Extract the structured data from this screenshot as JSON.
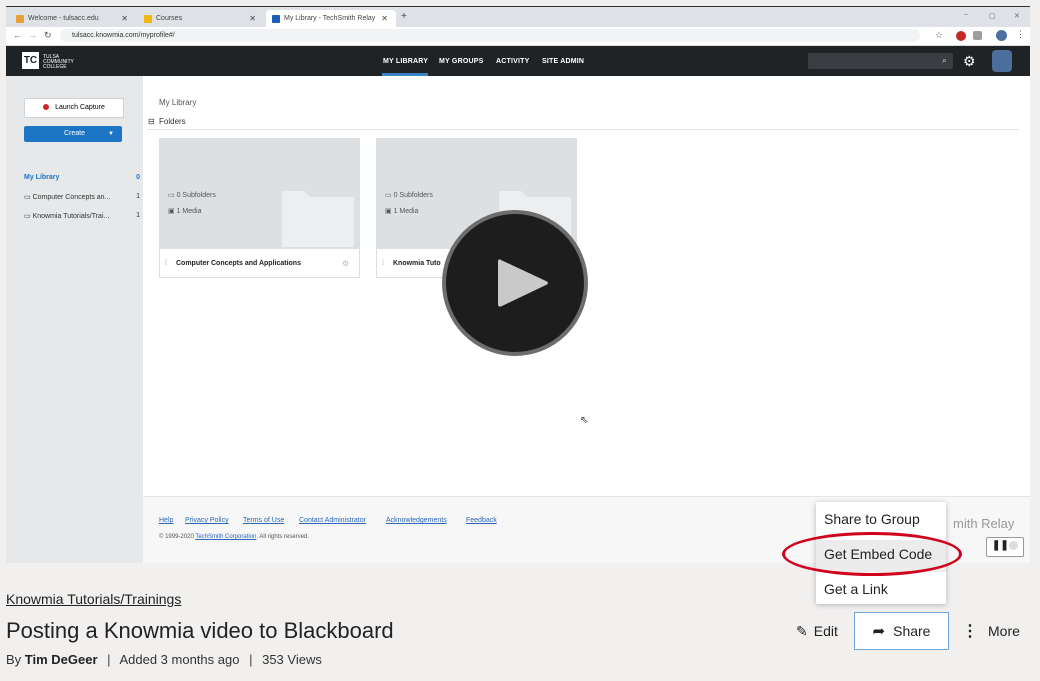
{
  "browser": {
    "tabs": [
      {
        "label": "Welcome - tulsacc.edu",
        "fav_color": "#e8a13a"
      },
      {
        "label": "Courses",
        "fav_color": "#f2b70c"
      },
      {
        "label": "My Library - TechSmith Relay",
        "fav_color": "#1c5fb8"
      }
    ],
    "new_tab": "+",
    "url": "tulsacc.knowmia.com/myprofile#/",
    "window_controls": [
      "−",
      "▢",
      "✕"
    ]
  },
  "app": {
    "logo_mark": "TC",
    "logo_text": [
      "TULSA",
      "COMMUNITY",
      "COLLEGE"
    ],
    "nav": [
      "MY LIBRARY",
      "MY GROUPS",
      "ACTIVITY",
      "SITE ADMIN"
    ]
  },
  "sidebar": {
    "launch_label": "Launch Capture",
    "create_label": "Create",
    "items": [
      {
        "label": "My Library",
        "count": "0"
      },
      {
        "label": "Computer Concepts an...",
        "count": "1"
      },
      {
        "label": "Knowmia Tutorials/Trai...",
        "count": "1"
      }
    ]
  },
  "main": {
    "breadcrumb": "My Library",
    "folders_label": "Folders",
    "folders": [
      {
        "subfolders": "0 Subfolders",
        "media": "1 Media",
        "name": "Computer Concepts and Applications"
      },
      {
        "subfolders": "0 Subfolders",
        "media": "1 Media",
        "name": "Knowmia Tuto"
      }
    ]
  },
  "footer": {
    "links": [
      "Help",
      "Privacy Policy",
      "Terms of Use",
      "Contact Administrator",
      "Acknowledgements",
      "Feedback"
    ],
    "copyright_prefix": "© 1999-2020",
    "copyright_link": "TechSmith Corporation",
    "copyright_suffix": ". All rights reserved.",
    "brand": "mith Relay"
  },
  "share_menu": {
    "items": [
      "Share to Group",
      "Get Embed Code",
      "Get a Link"
    ],
    "highlight_color": "#d0021b"
  },
  "video": {
    "channel": "Knowmia Tutorials/Trainings",
    "title": "Posting a Knowmia video to Blackboard",
    "by_prefix": "By",
    "author": "Tim DeGeer",
    "added": "Added 3 months ago",
    "views": "353 Views",
    "separator": "|",
    "actions": {
      "edit": "Edit",
      "share": "Share",
      "more": "More"
    }
  }
}
